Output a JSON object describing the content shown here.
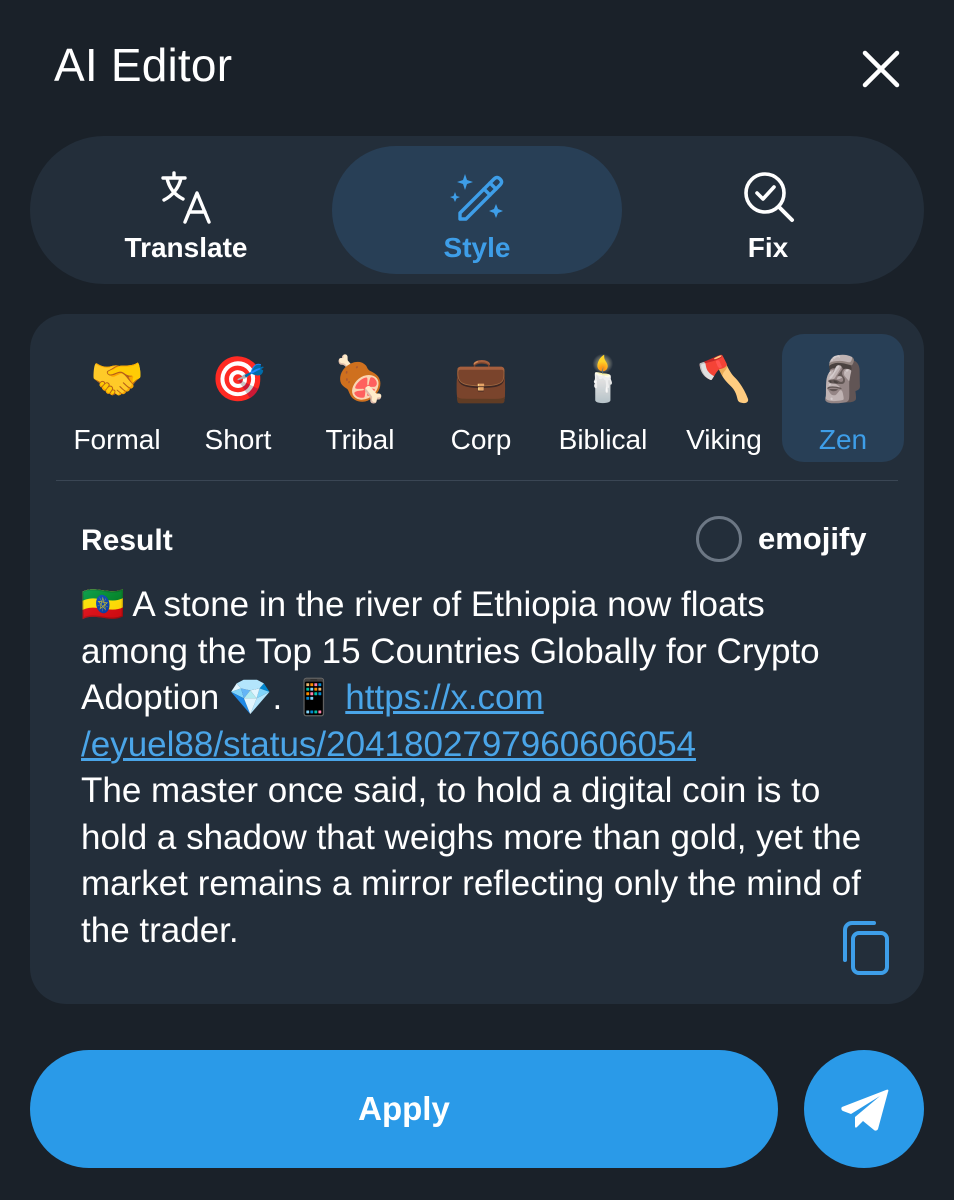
{
  "header": {
    "title": "AI Editor"
  },
  "modes": [
    {
      "label": "Translate",
      "icon": "translate-icon",
      "active": false
    },
    {
      "label": "Style",
      "icon": "magic-wand-icon",
      "active": true
    },
    {
      "label": "Fix",
      "icon": "search-check-icon",
      "active": false
    }
  ],
  "styles": [
    {
      "label": "Formal",
      "emoji": "🤝"
    },
    {
      "label": "Short",
      "emoji": "🎯"
    },
    {
      "label": "Tribal",
      "emoji": "🍖"
    },
    {
      "label": "Corp",
      "emoji": "💼"
    },
    {
      "label": "Biblical",
      "emoji": "🕯️"
    },
    {
      "label": "Viking",
      "emoji": "🪓"
    },
    {
      "label": "Zen",
      "emoji": "🗿"
    }
  ],
  "result": {
    "label": "Result",
    "emojify_label": "emojify",
    "emojify_checked": false,
    "flag": "🇪🇹",
    "text_part1": "A stone in the river of Ethiopia now floats among the Top 15 Countries Globally for Crypto Adoption",
    "diamond": "💎",
    "phone": "📱",
    "link": "https://x.com/eyuel88/status/2041802797960606054",
    "link_line1": "https://x.com",
    "link_line2": "/eyuel88/status/2041802797960606054",
    "text_part2": "The master once said, to hold a digital coin is to hold a shadow that weighs more than gold, yet the market remains a mirror reflecting only the mind of the trader."
  },
  "actions": {
    "apply_label": "Apply"
  },
  "colors": {
    "background": "#1a2129",
    "panel": "#232e3a",
    "active_pill": "#283f56",
    "accent": "#3e9ee8",
    "button": "#2a9ae8"
  }
}
